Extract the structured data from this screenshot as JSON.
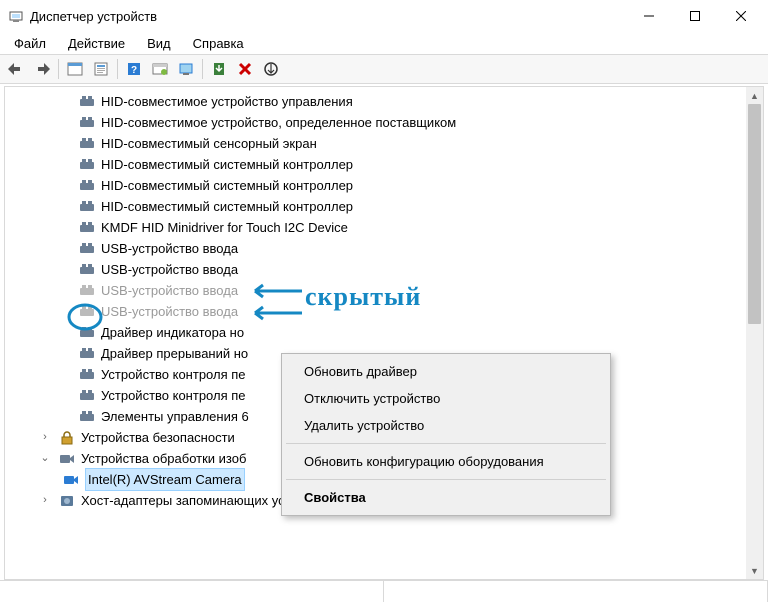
{
  "window": {
    "title": "Диспетчер устройств"
  },
  "menubar": [
    "Файл",
    "Действие",
    "Вид",
    "Справка"
  ],
  "tree": {
    "items": [
      {
        "label": "HID-совместимое устройство управления",
        "faded": false
      },
      {
        "label": "HID-совместимое устройство, определенное поставщиком",
        "faded": false
      },
      {
        "label": "HID-совместимый сенсорный экран",
        "faded": false
      },
      {
        "label": "HID-совместимый системный контроллер",
        "faded": false
      },
      {
        "label": "HID-совместимый системный контроллер",
        "faded": false
      },
      {
        "label": "HID-совместимый системный контроллер",
        "faded": false
      },
      {
        "label": "KMDF HID Minidriver for Touch I2C Device",
        "faded": false
      },
      {
        "label": "USB-устройство ввода",
        "faded": false
      },
      {
        "label": "USB-устройство ввода",
        "faded": false
      },
      {
        "label": "USB-устройство ввода",
        "faded": true
      },
      {
        "label": "USB-устройство ввода",
        "faded": true
      },
      {
        "label": "Драйвер индикатора но",
        "faded": false
      },
      {
        "label": "Драйвер прерываний но",
        "faded": false
      },
      {
        "label": "Устройство контроля пе",
        "faded": false
      },
      {
        "label": "Устройство контроля пе",
        "faded": false
      },
      {
        "label": "Элементы управления 6",
        "faded": false
      }
    ],
    "categories": [
      {
        "label": "Устройства безопасности",
        "icon": "lock",
        "expanded": false
      },
      {
        "label": "Устройства обработки изоб",
        "icon": "camera",
        "expanded": true
      }
    ],
    "camera": "Intel(R) AVStream Camera",
    "storage": "Хост-адаптеры запоминающих устройств"
  },
  "context_menu": [
    {
      "label": "Обновить драйвер",
      "type": "item"
    },
    {
      "label": "Отключить устройство",
      "type": "item"
    },
    {
      "label": "Удалить устройство",
      "type": "item"
    },
    {
      "type": "sep"
    },
    {
      "label": "Обновить конфигурацию оборудования",
      "type": "item"
    },
    {
      "type": "sep"
    },
    {
      "label": "Свойства",
      "type": "item",
      "default": true
    }
  ],
  "annotation": {
    "text": "скрытый"
  }
}
